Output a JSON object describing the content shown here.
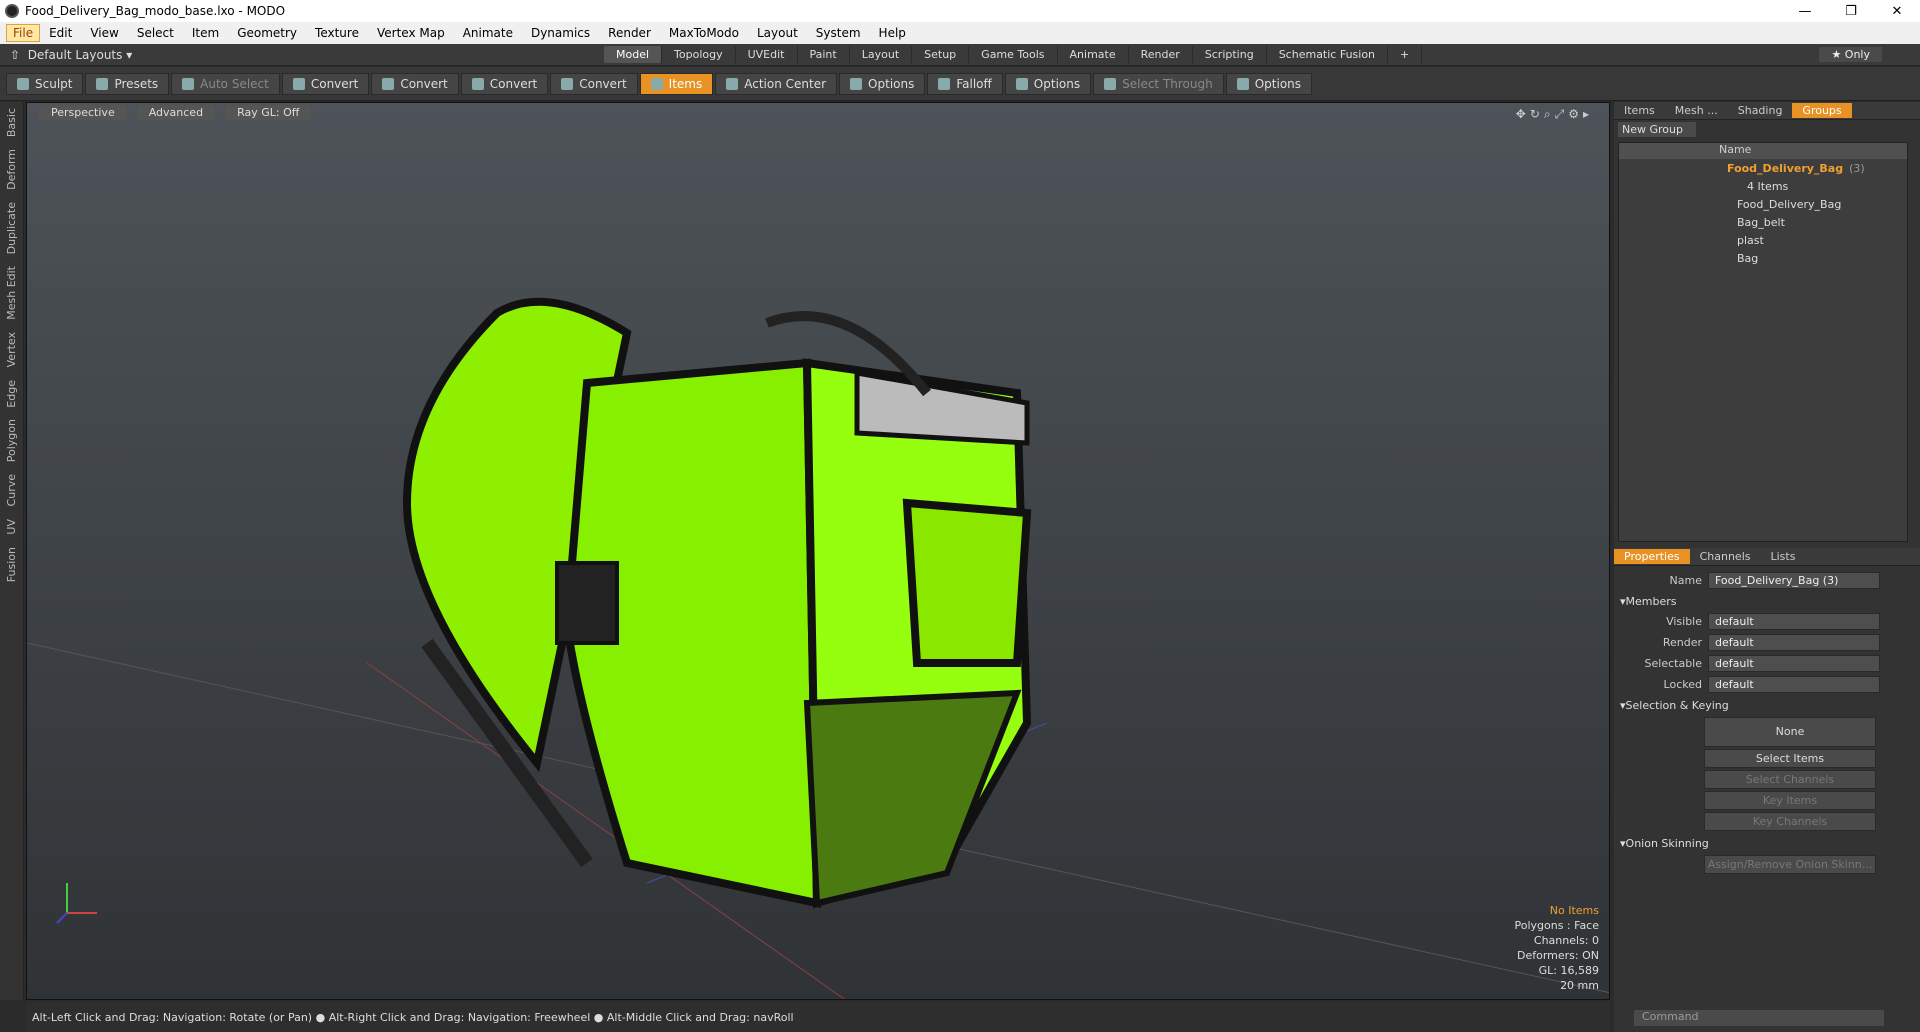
{
  "window": {
    "title": "Food_Delivery_Bag_modo_base.lxo - MODO"
  },
  "menu": [
    "File",
    "Edit",
    "View",
    "Select",
    "Item",
    "Geometry",
    "Texture",
    "Vertex Map",
    "Animate",
    "Dynamics",
    "Render",
    "MaxToModo",
    "Layout",
    "System",
    "Help"
  ],
  "layout": {
    "dropdown": "Default Layouts",
    "only": "Only",
    "tabs": [
      "Model",
      "Topology",
      "UVEdit",
      "Paint",
      "Layout",
      "Setup",
      "Game Tools",
      "Animate",
      "Render",
      "Scripting",
      "Schematic Fusion"
    ]
  },
  "toolbar": [
    "Sculpt",
    "Presets",
    "Auto Select",
    "Convert",
    "Convert",
    "Convert",
    "Convert",
    "Items",
    "Action Center",
    "Options",
    "Falloff",
    "Options",
    "Select Through",
    "Options"
  ],
  "left_tabs": [
    "Basic",
    "Deform",
    "Duplicate",
    "Mesh Edit",
    "Vertex",
    "Edge",
    "Polygon",
    "Curve",
    "UV",
    "Fusion"
  ],
  "viewport": {
    "modes": [
      "Perspective",
      "Advanced",
      "Ray GL: Off"
    ],
    "info": [
      "No Items",
      "Polygons : Face",
      "Channels: 0",
      "Deformers: ON",
      "GL: 16,589",
      "20 mm"
    ]
  },
  "status": "Alt-Left Click and Drag: Navigation: Rotate (or Pan) ● Alt-Right Click and Drag: Navigation: Freewheel ● Alt-Middle Click and Drag: navRoll",
  "panel": {
    "tabs": [
      "Items",
      "Mesh ...",
      "Shading",
      "Groups"
    ],
    "new_group": "New Group",
    "col_name": "Name",
    "group": "Food_Delivery_Bag",
    "group_count": "(3)",
    "group_items": "4 Items",
    "children": [
      "Food_Delivery_Bag",
      "Bag_belt",
      "plast",
      "Bag"
    ]
  },
  "props": {
    "tabs": [
      "Properties",
      "Channels",
      "Lists"
    ],
    "name_label": "Name",
    "name_value": "Food_Delivery_Bag (3)",
    "members": "Members",
    "rows": [
      {
        "label": "Visible",
        "value": "default"
      },
      {
        "label": "Render",
        "value": "default"
      },
      {
        "label": "Selectable",
        "value": "default"
      },
      {
        "label": "Locked",
        "value": "default"
      }
    ],
    "sel_keying": "Selection & Keying",
    "none": "None",
    "buttons": [
      "Select Items",
      "Select Channels",
      "Key Items",
      "Key Channels"
    ],
    "onion": "Onion Skinning",
    "onion_btn": "Assign/Remove Onion Skinn...",
    "command": "Command"
  }
}
